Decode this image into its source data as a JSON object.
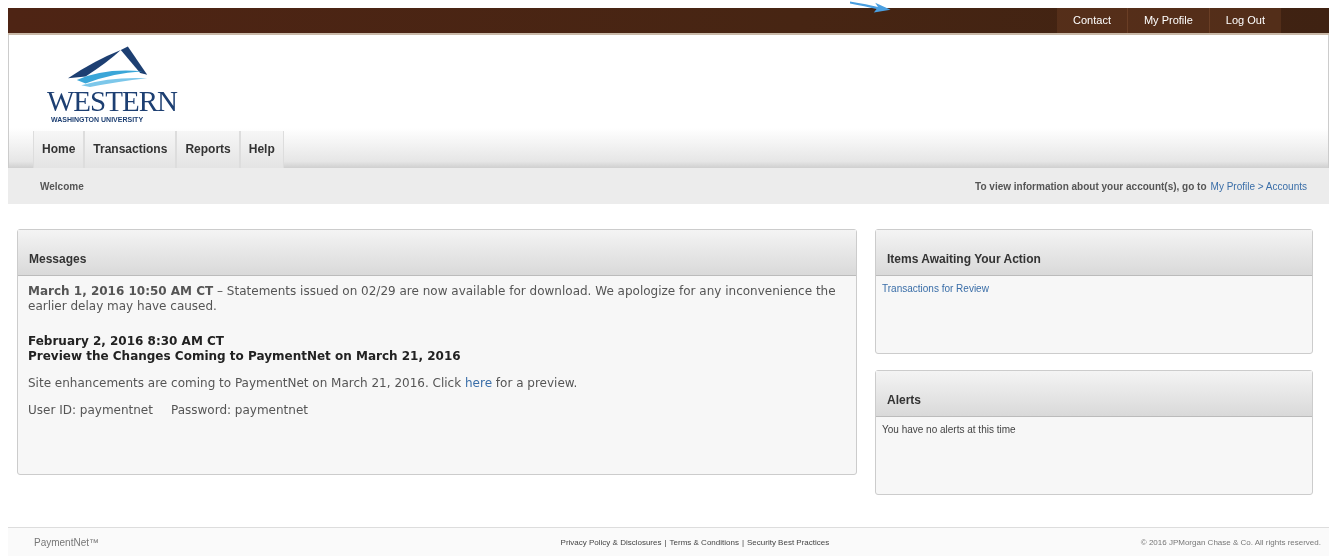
{
  "top_links": [
    "Contact",
    "My Profile",
    "Log Out"
  ],
  "logo": {
    "name": "WESTERN",
    "subtitle": "WASHINGTON UNIVERSITY"
  },
  "tabs": [
    {
      "label": "Home",
      "selected": false
    },
    {
      "label": "Transactions",
      "selected": false
    },
    {
      "label": "Reports",
      "selected": false
    },
    {
      "label": "Help",
      "selected": false
    }
  ],
  "welcome_bar": {
    "title": "Welcome",
    "info": "To view information about your account(s), go to",
    "link": "My Profile > Accounts"
  },
  "messages": {
    "title": "Messages",
    "first": "**March 1, 2016 10:50 AM CT** – Statements issued on 02/29 are now available for download. We apologize for any inconvenience the earlier delay may have caused.",
    "heading_lines": [
      "February 2, 2016 8:30 AM CT",
      "Preview the Changes Coming to PaymentNet on March 21, 2016"
    ],
    "body_before": "Site enhancements are coming to PaymentNet on March 21, 2016. Click",
    "body_link": "here",
    "body_after": "for a preview.",
    "credentials": [
      "User ID: paymentnet",
      "Password: paymentnet"
    ]
  },
  "action_items": {
    "title": "Items Awaiting Your Action",
    "links": [
      "Transactions for Review"
    ]
  },
  "alerts": {
    "title": "Alerts",
    "text": "You have no alerts at this time"
  },
  "footer": {
    "brand": "PaymentNet™",
    "links": [
      "Privacy Policy & Disclosures",
      "Terms & Conditions",
      "Security Best Practices"
    ],
    "separator": "|",
    "copyright": "© 2016 JPMorgan Chase & Co. All rights reserved."
  }
}
